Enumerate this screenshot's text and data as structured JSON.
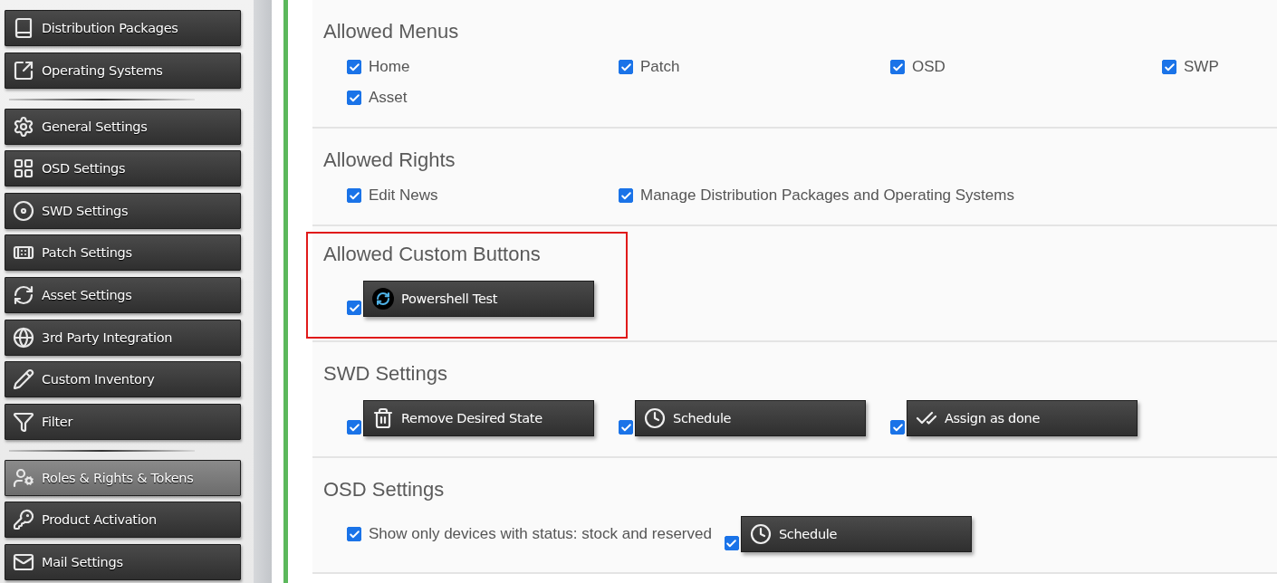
{
  "sidebar": {
    "groups": [
      {
        "items": [
          {
            "label": "Distribution Packages",
            "selected": false
          },
          {
            "label": "Operating Systems",
            "selected": false
          }
        ]
      },
      {
        "items": [
          {
            "label": "General Settings",
            "selected": false
          },
          {
            "label": "OSD Settings",
            "selected": false
          },
          {
            "label": "SWD Settings",
            "selected": false
          },
          {
            "label": "Patch Settings",
            "selected": false
          },
          {
            "label": "Asset Settings",
            "selected": false
          },
          {
            "label": "3rd Party Integration",
            "selected": false
          },
          {
            "label": "Custom Inventory",
            "selected": false
          },
          {
            "label": "Filter",
            "selected": false
          }
        ]
      },
      {
        "items": [
          {
            "label": "Roles & Rights & Tokens",
            "selected": true
          },
          {
            "label": "Product Activation",
            "selected": false
          },
          {
            "label": "Mail Settings",
            "selected": false
          }
        ]
      }
    ]
  },
  "sections": [
    {
      "title": "Allowed Menus",
      "highlighted": false,
      "items": [
        {
          "kind": "checkbox",
          "label": "Home",
          "checked": true
        },
        {
          "kind": "checkbox",
          "label": "Patch",
          "checked": true
        },
        {
          "kind": "checkbox",
          "label": "OSD",
          "checked": true
        },
        {
          "kind": "checkbox",
          "label": "SWP",
          "checked": true
        },
        {
          "kind": "checkbox",
          "label": "Asset",
          "checked": true
        }
      ]
    },
    {
      "title": "Allowed Rights",
      "highlighted": false,
      "items": [
        {
          "kind": "checkbox",
          "label": "Edit News",
          "checked": true
        },
        {
          "kind": "checkbox",
          "label": "Manage Distribution Packages and Operating Systems",
          "checked": true
        }
      ]
    },
    {
      "title": "Allowed Custom Buttons",
      "highlighted": true,
      "items": [
        {
          "kind": "button",
          "label": "Powershell Test",
          "checked": true
        }
      ]
    },
    {
      "title": "SWD Settings",
      "highlighted": false,
      "items": [
        {
          "kind": "button",
          "label": "Remove Desired State",
          "checked": true
        },
        {
          "kind": "button",
          "label": "Schedule",
          "checked": true
        },
        {
          "kind": "button",
          "label": "Assign as done",
          "checked": true
        }
      ]
    },
    {
      "title": "OSD Settings",
      "highlighted": false,
      "items": [
        {
          "kind": "checkbox",
          "label": "Show only devices with status: stock and reserved",
          "checked": true
        },
        {
          "kind": "button",
          "label": "Schedule",
          "checked": true
        }
      ]
    }
  ]
}
